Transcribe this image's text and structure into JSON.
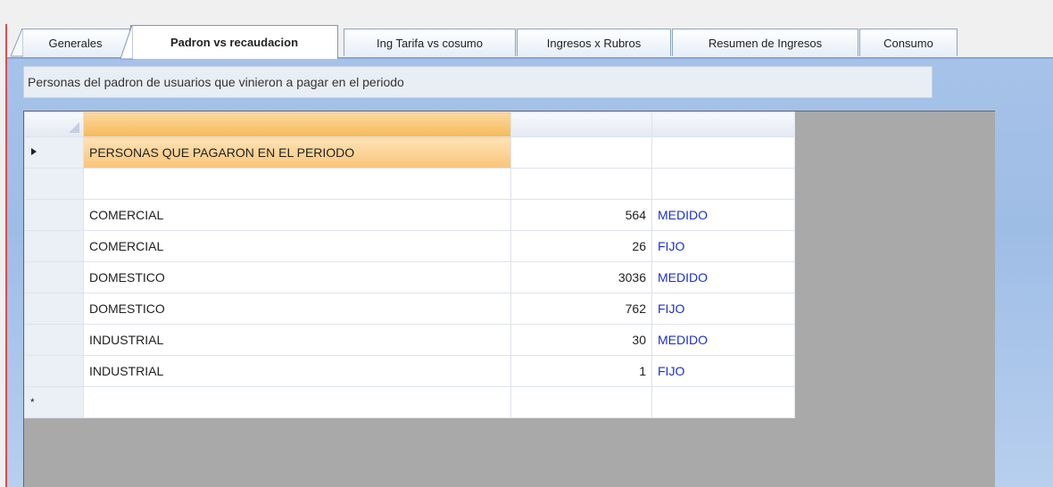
{
  "tabs": [
    {
      "label": "Generales",
      "active": false
    },
    {
      "label": "Padron vs recaudacion",
      "active": true
    },
    {
      "label": "Ing Tarifa vs cosumo",
      "active": false
    },
    {
      "label": "Ingresos x Rubros",
      "active": false
    },
    {
      "label": "Resumen de Ingresos",
      "active": false
    },
    {
      "label": "Consumo",
      "active": false
    }
  ],
  "caption": "Personas del padron de usuarios que vinieron a pagar en el periodo",
  "grid": {
    "rows": [
      {
        "marker": "current",
        "col1": "PERSONAS QUE PAGARON EN EL PERIODO",
        "col2": "",
        "col3": ""
      },
      {
        "marker": "",
        "col1": "",
        "col2": "",
        "col3": ""
      },
      {
        "marker": "",
        "col1": "COMERCIAL",
        "col2": "564",
        "col3": "MEDIDO"
      },
      {
        "marker": "",
        "col1": "COMERCIAL",
        "col2": "26",
        "col3": "FIJO"
      },
      {
        "marker": "",
        "col1": "DOMESTICO",
        "col2": "3036",
        "col3": "MEDIDO"
      },
      {
        "marker": "",
        "col1": "DOMESTICO",
        "col2": "762",
        "col3": "FIJO"
      },
      {
        "marker": "",
        "col1": "INDUSTRIAL",
        "col2": "30",
        "col3": "MEDIDO"
      },
      {
        "marker": "",
        "col1": "INDUSTRIAL",
        "col2": "1",
        "col3": "FIJO"
      }
    ],
    "new_row_marker": "*"
  },
  "colors": {
    "link_blue": "#1a2fd1",
    "selected_orange": "#f7b95a",
    "grid_bg": "#a9a9a9"
  }
}
